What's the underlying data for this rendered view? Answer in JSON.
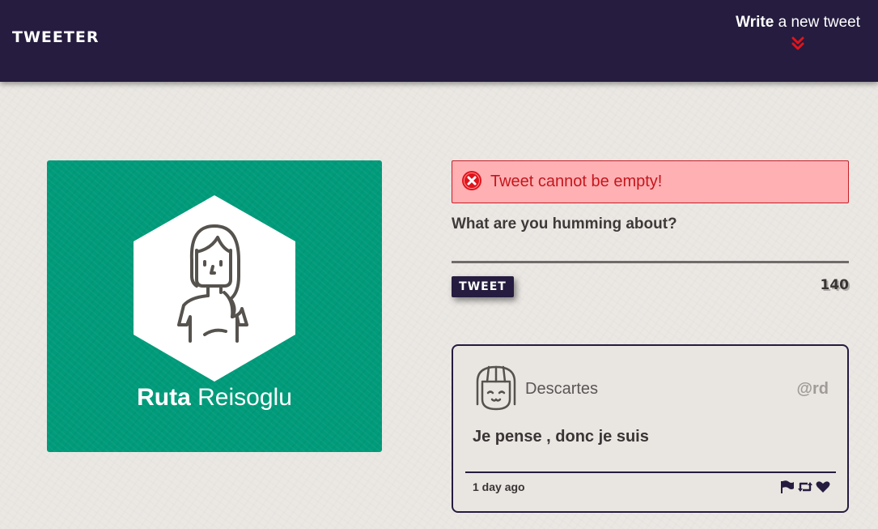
{
  "nav": {
    "brand": "TWEETER",
    "compose_toggle": {
      "strong": "Write",
      "light": "a new tweet"
    },
    "chevron_color": "#e0141c"
  },
  "profile": {
    "first_name": "Ruta",
    "last_name": "Reisoglu",
    "card_color": "#009b7a",
    "avatar": "girl-avatar-icon"
  },
  "composer": {
    "error_message": "Tweet cannot be empty!",
    "error_icon": "error-x-icon",
    "prompt": "What are you humming about?",
    "textarea_value": "",
    "tweet_button": "TWEET",
    "char_counter": "140"
  },
  "tweets": [
    {
      "author": "Descartes",
      "handle": "@rd",
      "avatar": "smiling-face-icon",
      "text": "Je pense , donc je suis",
      "time": "1 day ago",
      "actions": [
        "flag-icon",
        "retweet-icon",
        "heart-icon"
      ]
    }
  ],
  "colors": {
    "nav_bg": "#251c3f",
    "error_bg": "#ffb0b3",
    "error_text": "#c4161c",
    "card_border": "#251c3f"
  }
}
